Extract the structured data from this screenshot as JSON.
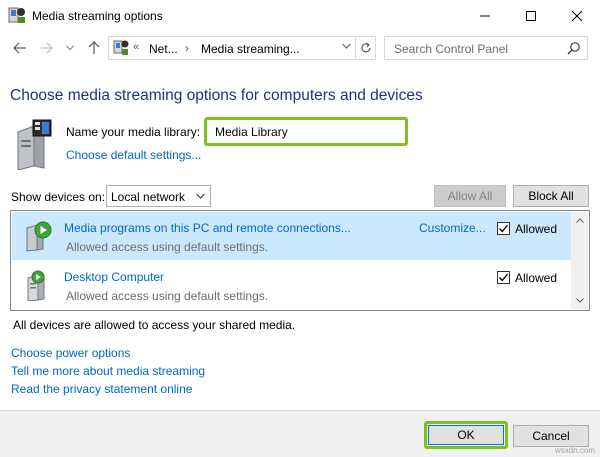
{
  "window": {
    "title": "Media streaming options",
    "minimize_icon": "minimize-icon",
    "maximize_icon": "maximize-icon",
    "close_icon": "close-icon"
  },
  "nav": {
    "back_icon": "arrow-left-icon",
    "forward_icon": "arrow-right-icon",
    "up_icon": "arrow-up-icon",
    "address_overflow": "«",
    "breadcrumb_1": "Net...",
    "breadcrumb_sep": "›",
    "breadcrumb_2": "Media streaming...",
    "search_placeholder": "Search Control Panel"
  },
  "main": {
    "heading": "Choose media streaming options for computers and devices",
    "library_label": "Name your media library:",
    "library_value": "Media Library",
    "choose_default_link": "Choose default settings...",
    "show_devices_label": "Show devices on:",
    "show_devices_value": "Local network",
    "allow_all_label": "Allow All",
    "block_all_label": "Block All",
    "devices": [
      {
        "name": "Media programs on this PC and remote connections...",
        "description": "Allowed access using default settings.",
        "customize": "Customize...",
        "allowed_label": "Allowed",
        "allowed": true,
        "selected": true
      },
      {
        "name": "Desktop Computer",
        "description": "Allowed access using default settings.",
        "customize": "",
        "allowed_label": "Allowed",
        "allowed": true,
        "selected": false
      }
    ],
    "all_devices_status": "All devices are allowed to access your shared media.",
    "links": {
      "power": "Choose power options",
      "tell_more": "Tell me more about media streaming",
      "privacy": "Read the privacy statement online"
    }
  },
  "footer": {
    "ok_label": "OK",
    "cancel_label": "Cancel"
  },
  "watermark": "wsxdn.com",
  "colors": {
    "heading": "#1e3287",
    "link": "#0066cc",
    "highlight_border": "#7fc01e",
    "selected_row": "#cce8ff"
  }
}
